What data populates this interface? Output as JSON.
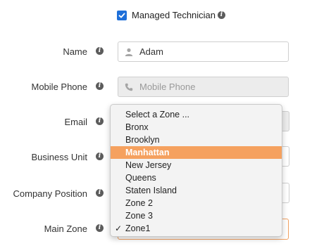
{
  "managed_technician": {
    "label": "Managed Technician",
    "checked": true
  },
  "form": {
    "name": {
      "label": "Name",
      "value": "Adam",
      "icon": "person-icon"
    },
    "mobile_phone": {
      "label": "Mobile Phone",
      "placeholder": "Mobile Phone",
      "icon": "phone-icon"
    },
    "email": {
      "label": "Email"
    },
    "business_unit": {
      "label": "Business Unit"
    },
    "company_position": {
      "label": "Company Position"
    },
    "main_zone": {
      "label": "Main Zone",
      "selected": "Zone1"
    }
  },
  "zone_dropdown": {
    "options": [
      "Select a Zone ...",
      "Bronx",
      "Brooklyn",
      "Manhattan",
      "New Jersey",
      "Queens",
      "Staten Island",
      "Zone 2",
      "Zone 3",
      "Zone1"
    ],
    "highlighted": "Manhattan",
    "checked": "Zone1",
    "check_mark": "✓"
  },
  "colors": {
    "accent_blue": "#1e6fd9",
    "highlight_orange": "#f5a15f",
    "focus_border": "#f0a060"
  }
}
